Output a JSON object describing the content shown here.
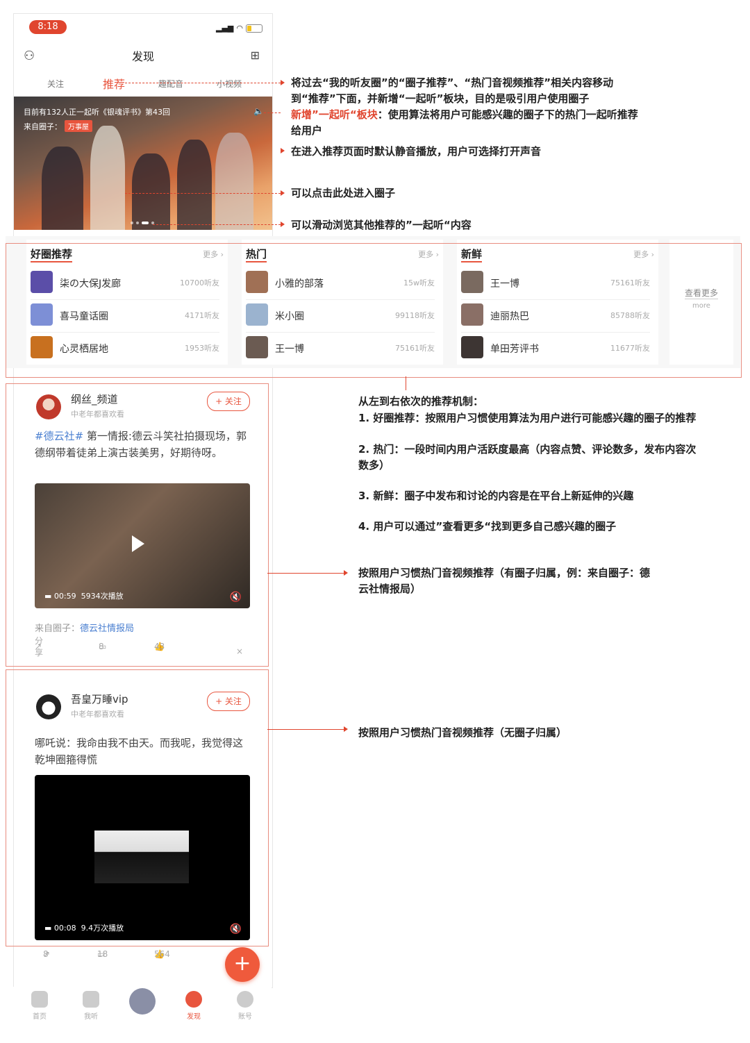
{
  "status": {
    "time": "8:18"
  },
  "nav": {
    "title": "发现"
  },
  "tabs": [
    "关注",
    "推荐",
    "趣配音",
    "小视频"
  ],
  "hero": {
    "line1": "目前有132人正一起听《银魂评书》第43回",
    "from_label": "来自圈子：",
    "tag": "万事屋"
  },
  "annotations": {
    "a1": "将过去“我的听友圈”的“圈子推荐”、“热门音视频推荐”相关内容移动",
    "a1b": "到“推荐”下面，并新增“一起听”板块，目的是吸引用户使用圈子",
    "a1c_red": "新增”一起听“板块",
    "a1c": "：使用算法将用户可能感兴趣的圈子下的热门一起听推荐",
    "a1d": "给用户",
    "a2": "在进入推荐页面时默认静音播放，用户可选择打开声音",
    "a3": "可以点击此处进入圈子",
    "a4": "可以滑动浏览其他推荐的”一起听“内容",
    "b0": "从左到右依次的推荐机制：",
    "b1": "1. 好圈推荐：按照用户习惯使用算法为用户进行可能感兴趣的圈子的推荐",
    "b2": "2. 热门：一段时间内用户活跃度最高（内容点赞、评论数多，发布内容次",
    "b2b": "数多）",
    "b3": "3. 新鲜：圈子中发布和讨论的内容是在平台上新延伸的兴趣",
    "b4": "4. 用户可以通过”查看更多“找到更多自己感兴趣的圈子",
    "c1": "按照用户习惯热门音视频推荐（有圈子归属，例：来自圈子：德",
    "c1b": "云社情报局）",
    "d1": "按照用户习惯热门音视频推荐（无圈子归属）"
  },
  "circles": [
    {
      "title": "好圈推荐",
      "more": "更多 ›",
      "items": [
        {
          "name": "柒の大保J发廊",
          "count": "10700听友",
          "color": "#5b4ea8"
        },
        {
          "name": "喜马童话圈",
          "count": "4171听友",
          "color": "#7d8fd6"
        },
        {
          "name": "心灵栖居地",
          "count": "1953听友",
          "color": "#c8701f"
        }
      ]
    },
    {
      "title": "热门",
      "more": "更多 ›",
      "items": [
        {
          "name": "小雅的部落",
          "count": "15w听友",
          "color": "#a07055"
        },
        {
          "name": "米小圈",
          "count": "99118听友",
          "color": "#9bb3cf"
        },
        {
          "name": "王一博",
          "count": "75161听友",
          "color": "#6b5b52"
        }
      ]
    },
    {
      "title": "新鲜",
      "more": "更多 ›",
      "items": [
        {
          "name": "王一博",
          "count": "75161听友",
          "color": "#7a6a60"
        },
        {
          "name": "迪丽热巴",
          "count": "85788听友",
          "color": "#8a6f66"
        },
        {
          "name": "单田芳评书",
          "count": "11677听友",
          "color": "#3d3533"
        }
      ]
    }
  ],
  "see_more": {
    "label": "查看更多",
    "sub": "more"
  },
  "post1": {
    "user": "纲丝_频道",
    "sub": "中老年都喜欢看",
    "follow": "+ 关注",
    "hashtag": "#德云社#",
    "text": " 第一情报:德云斗笑社拍摄现场，郭德纲带着徒弟上演古装美男，好期待呀。",
    "duration": "00:59",
    "plays": "5934次播放",
    "from_label": "来自圈子：",
    "from_circle": "德云社情报局",
    "share": "分享",
    "comments": "8",
    "likes": "43"
  },
  "post2": {
    "user": "吾皇万睡vip",
    "sub": "中老年都喜欢看",
    "follow": "+ 关注",
    "text": "哪吒说：我命由我不由天。而我呢，我觉得这乾坤圈箍得慌",
    "duration": "00:08",
    "plays": "9.4万次播放",
    "share": "8",
    "comments": "18",
    "likes": "564"
  },
  "tabbar": [
    "首页",
    "我听",
    "",
    "发现",
    "账号"
  ]
}
